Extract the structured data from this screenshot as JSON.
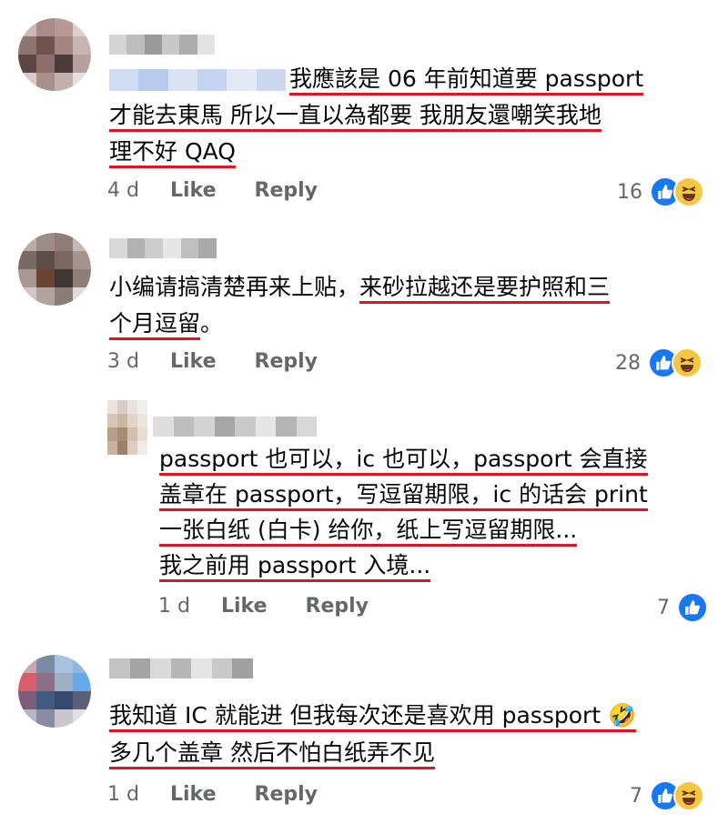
{
  "colors": {
    "underline": "#e0141e",
    "meta": "#65676b",
    "like": "#1877f2",
    "haha": "#f7c744"
  },
  "actions": {
    "like": "Like",
    "reply": "Reply"
  },
  "comments": [
    {
      "lines": [
        "我應該是 06 年前知道要 passport",
        "才能去東馬 所以一直以為都要 我朋友還嘲笑我地",
        "理不好 QAQ"
      ],
      "time": "4 d",
      "reaction_count": "16",
      "reactions": [
        "like-icon",
        "haha-icon"
      ]
    },
    {
      "lines_a": [
        "小编请搞清楚再来上贴，",
        "来砂拉越还是要护照和三"
      ],
      "lines_b": [
        "个月逗留",
        "。"
      ],
      "time": "3 d",
      "reaction_count": "28",
      "reactions": [
        "like-icon",
        "haha-icon"
      ]
    },
    {
      "lines": [
        "passport 也可以，ic 也可以，passport 会直接",
        "盖章在 passport，写逗留期限，ic 的话会 print",
        "一张白纸 (白卡) 给你，纸上写逗留期限...",
        "我之前用 passport 入境..."
      ],
      "time": "1 d",
      "reaction_count": "7",
      "reactions": [
        "like-icon"
      ]
    },
    {
      "lines": [
        "我知道 IC 就能进 但我每次还是喜欢用 passport",
        "多几个盖章 然后不怕白纸弄不见"
      ],
      "emoji": "🤣",
      "time": "1 d",
      "reaction_count": "7",
      "reactions": [
        "like-icon",
        "haha-icon"
      ]
    }
  ]
}
